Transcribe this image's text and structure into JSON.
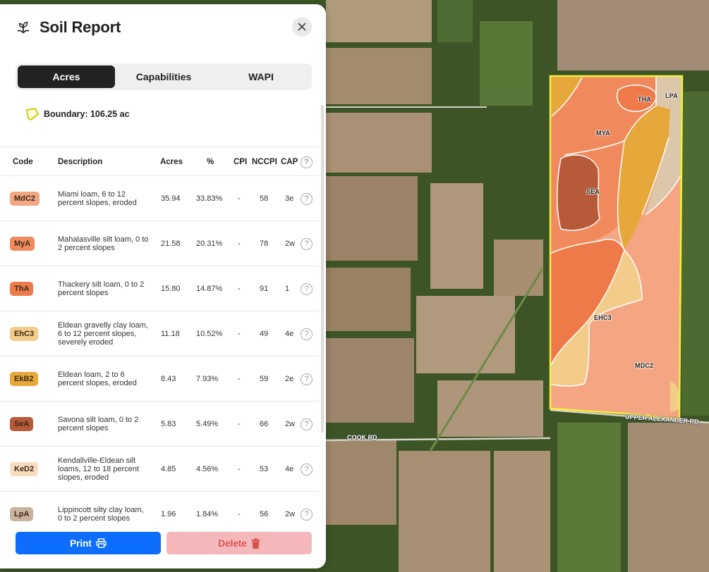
{
  "header": {
    "title": "Soil Report"
  },
  "tabs": [
    {
      "label": "Acres",
      "active": true
    },
    {
      "label": "Capabilities",
      "active": false
    },
    {
      "label": "WAPI",
      "active": false
    }
  ],
  "boundary": {
    "label": "Boundary: 106.25 ac"
  },
  "table": {
    "columns": [
      "Code",
      "Description",
      "Acres",
      "%",
      "CPI",
      "NCCPI",
      "CAP"
    ],
    "rows": [
      {
        "code": "MdC2",
        "color": "#f4a682",
        "description": "Miami loam, 6 to 12 percent slopes, eroded",
        "acres": "35.94",
        "pct": "33.83%",
        "cpi": "-",
        "nccpi": "58",
        "cap": "3e"
      },
      {
        "code": "MyA",
        "color": "#f08a5d",
        "description": "Mahalasville silt loam, 0 to 2 percent slopes",
        "acres": "21.58",
        "pct": "20.31%",
        "cpi": "-",
        "nccpi": "78",
        "cap": "2w"
      },
      {
        "code": "ThA",
        "color": "#ee7a4a",
        "description": "Thackery silt loam, 0 to 2 percent slopes",
        "acres": "15.80",
        "pct": "14.87%",
        "cpi": "-",
        "nccpi": "91",
        "cap": "1"
      },
      {
        "code": "EhC3",
        "color": "#f3cc8a",
        "description": "Eldean gravelly clay loam, 6 to 12 percent slopes, severely eroded",
        "acres": "11.18",
        "pct": "10.52%",
        "cpi": "-",
        "nccpi": "49",
        "cap": "4e"
      },
      {
        "code": "EkB2",
        "color": "#e6a83a",
        "description": "Eldean loam, 2 to 6 percent slopes, eroded",
        "acres": "8.43",
        "pct": "7.93%",
        "cpi": "-",
        "nccpi": "59",
        "cap": "2e"
      },
      {
        "code": "SeA",
        "color": "#b65a3a",
        "description": "Savona silt loam, 0 to 2 percent slopes",
        "acres": "5.83",
        "pct": "5.49%",
        "cpi": "-",
        "nccpi": "66",
        "cap": "2w"
      },
      {
        "code": "KeD2",
        "color": "#f7dcc0",
        "description": "Kendallville-Eldean silt loams, 12 to 18 percent slopes, eroded",
        "acres": "4.85",
        "pct": "4.56%",
        "cpi": "-",
        "nccpi": "53",
        "cap": "4e"
      },
      {
        "code": "LpA",
        "color": "#c9b29e",
        "description": "Lippincott silty clay loam, 0 to 2 percent slopes",
        "acres": "1.96",
        "pct": "1.84%",
        "cpi": "-",
        "nccpi": "56",
        "cap": "2w"
      }
    ]
  },
  "footer": {
    "print_label": "Print",
    "delete_label": "Delete"
  },
  "map": {
    "soil_labels": [
      "THA",
      "LPA",
      "MYA",
      "SEA",
      "EHC3",
      "MDC2"
    ],
    "roads": [
      "COOK RD",
      "UPPER ALEXANDER RD"
    ]
  },
  "colors": {
    "accent": "#0d6efd",
    "delete_bg": "#f5b8ba",
    "delete_text": "#d9534f",
    "boundary": "#f2f23a"
  }
}
